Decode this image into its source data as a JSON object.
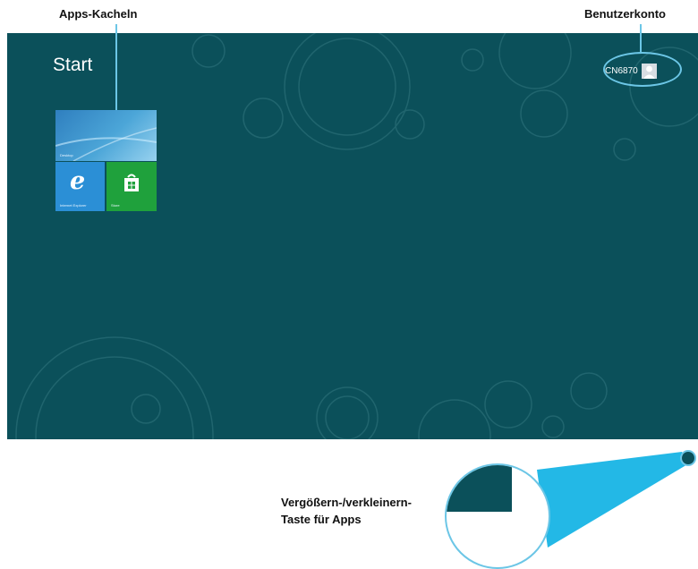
{
  "callouts": {
    "apps_tiles": "Apps-Kacheln",
    "user_account": "Benutzerkonto",
    "zoom_line1": "Vergößern-/verkleinern-",
    "zoom_line2": "Taste für Apps"
  },
  "start_screen": {
    "title": "Start",
    "account_name": "CN6870",
    "tiles": [
      {
        "label": "Desktop",
        "icon": "desktop-tile"
      },
      {
        "label": "Internet Explorer",
        "icon": "internet-explorer-icon"
      },
      {
        "label": "Store",
        "icon": "store-icon"
      }
    ]
  },
  "colors": {
    "background": "#0b505a",
    "callout_accent": "#6cc6e6",
    "ie_tile": "#2b8fd6",
    "store_tile": "#1fa13c"
  }
}
